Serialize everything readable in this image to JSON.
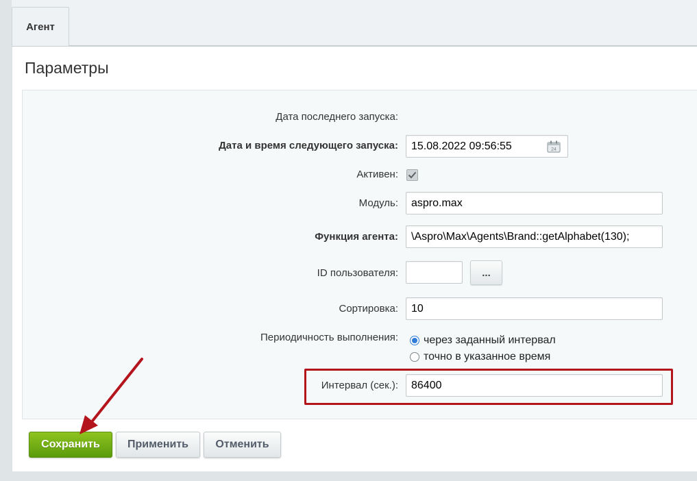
{
  "tabs": [
    {
      "label": "Агент"
    }
  ],
  "section_title": "Параметры",
  "form": {
    "last_run_label": "Дата последнего запуска:",
    "next_run_label": "Дата и время следующего запуска:",
    "next_run_value": "15.08.2022 09:56:55",
    "active_label": "Активен:",
    "active_checked": true,
    "module_label": "Модуль:",
    "module_value": "aspro.max",
    "function_label": "Функция агента:",
    "function_value": "\\Aspro\\Max\\Agents\\Brand::getAlphabet(130);",
    "user_id_label": "ID пользователя:",
    "user_id_value": "",
    "user_select_label": "...",
    "sort_label": "Сортировка:",
    "sort_value": "10",
    "period_label": "Периодичность выполнения:",
    "period_options": [
      {
        "label": "через заданный интервал",
        "selected": true
      },
      {
        "label": "точно в указанное время",
        "selected": false
      }
    ],
    "interval_label": "Интервал (сек.):",
    "interval_value": "86400"
  },
  "buttons": {
    "save": "Сохранить",
    "apply": "Применить",
    "cancel": "Отменить"
  },
  "colors": {
    "save_green": "#6aab12",
    "annotation_red": "#b4141b",
    "radio_blue": "#2f7bd8"
  }
}
